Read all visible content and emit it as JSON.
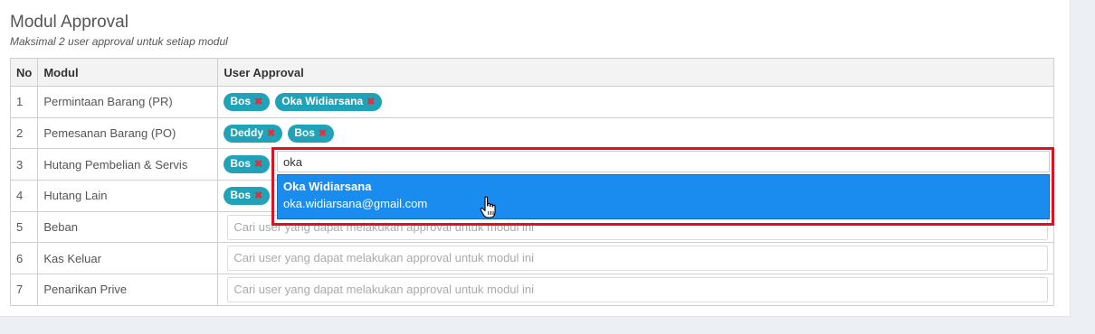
{
  "section": {
    "title": "Modul Approval",
    "subtitle": "Maksimal 2 user approval untuk setiap modul"
  },
  "table": {
    "headers": [
      "No",
      "Modul",
      "User Approval"
    ],
    "rows": [
      {
        "no": "1",
        "modul": "Permintaan Barang (PR)",
        "tags": [
          "Bos",
          "Oka Widiarsana"
        ]
      },
      {
        "no": "2",
        "modul": "Pemesanan Barang (PO)",
        "tags": [
          "Deddy",
          "Bos"
        ]
      },
      {
        "no": "3",
        "modul": "Hutang Pembelian & Servis",
        "tags": [
          "Bos"
        ]
      },
      {
        "no": "4",
        "modul": "Hutang Lain",
        "tags": [
          "Bos"
        ]
      },
      {
        "no": "5",
        "modul": "Beban",
        "placeholder": "Cari user yang dapat melakukan approval untuk modul ini"
      },
      {
        "no": "6",
        "modul": "Kas Keluar",
        "placeholder": "Cari user yang dapat melakukan approval untuk modul ini"
      },
      {
        "no": "7",
        "modul": "Penarikan Prive",
        "placeholder": "Cari user yang dapat melakukan approval untuk modul ini"
      }
    ]
  },
  "tag_remove_glyph": "✖",
  "search": {
    "value": "oka",
    "suggestion": {
      "name": "Oka Widiarsana",
      "email": "oka.widiarsana@gmail.com"
    }
  },
  "colors": {
    "tag_bg": "#20a3b8",
    "tag_remove": "#e0303a",
    "dropdown_highlight": "#1a8cf0",
    "annotation_box": "#e0101f"
  },
  "icons": {
    "cursor": "hand-pointer-icon",
    "remove": "close-icon"
  }
}
